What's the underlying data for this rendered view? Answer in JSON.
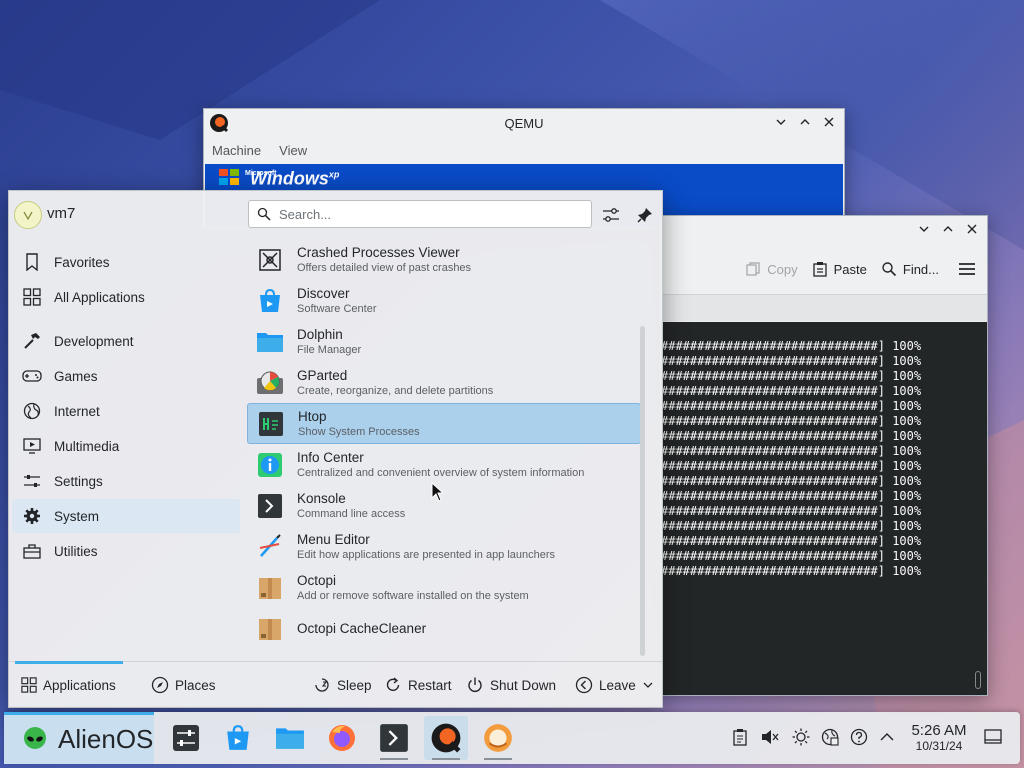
{
  "qemu": {
    "title": "QEMU",
    "menu": [
      "Machine",
      "View"
    ],
    "guest_logo": {
      "brand_small": "Microsoft",
      "brand": "Windows",
      "suffix": "xp"
    }
  },
  "konsole": {
    "toolbar": {
      "copy": "Copy",
      "paste": "Paste",
      "find": "Find..."
    },
    "progress_suffix": "] 100%",
    "progress_bar": "##############################",
    "progress_rows": 16
  },
  "launcher": {
    "username": "vm7",
    "search_placeholder": "Search...",
    "categories": [
      {
        "label": "Favorites",
        "icon": "bookmark-icon"
      },
      {
        "label": "All Applications",
        "icon": "grid-icon"
      },
      {
        "label": "Development",
        "icon": "hammer-icon"
      },
      {
        "label": "Games",
        "icon": "gamepad-icon"
      },
      {
        "label": "Internet",
        "icon": "globe-icon"
      },
      {
        "label": "Multimedia",
        "icon": "media-icon"
      },
      {
        "label": "Settings",
        "icon": "sliders-icon"
      },
      {
        "label": "System",
        "icon": "gear-icon",
        "selected": true
      },
      {
        "label": "Utilities",
        "icon": "toolbox-icon"
      }
    ],
    "apps": [
      {
        "name": "Crashed Processes Viewer",
        "desc": "Offers detailed view of past crashes",
        "icon": "crash-viewer-icon"
      },
      {
        "name": "Discover",
        "desc": "Software Center",
        "icon": "discover-icon"
      },
      {
        "name": "Dolphin",
        "desc": "File Manager",
        "icon": "folder-icon"
      },
      {
        "name": "GParted",
        "desc": "Create, reorganize, and delete partitions",
        "icon": "gparted-icon"
      },
      {
        "name": "Htop",
        "desc": "Show System Processes",
        "icon": "htop-icon",
        "selected": true
      },
      {
        "name": "Info Center",
        "desc": "Centralized and convenient overview of system information",
        "icon": "info-icon"
      },
      {
        "name": "Konsole",
        "desc": "Command line access",
        "icon": "terminal-icon"
      },
      {
        "name": "Menu Editor",
        "desc": "Edit how applications are presented in app launchers",
        "icon": "menu-editor-icon"
      },
      {
        "name": "Octopi",
        "desc": "Add or remove software installed on the system",
        "icon": "package-icon"
      },
      {
        "name": "Octopi CacheCleaner",
        "desc": "",
        "icon": "package-icon"
      }
    ],
    "bottom": {
      "applications": "Applications",
      "places": "Places",
      "sleep": "Sleep",
      "restart": "Restart",
      "shutdown": "Shut Down",
      "leave": "Leave"
    }
  },
  "taskbar": {
    "launcher_label": "AlienOS",
    "time": "5:26 AM",
    "date": "10/31/24"
  },
  "colors": {
    "accent": "#3daee9",
    "selection": "#aad0ec",
    "terminal_bg": "#232627"
  }
}
